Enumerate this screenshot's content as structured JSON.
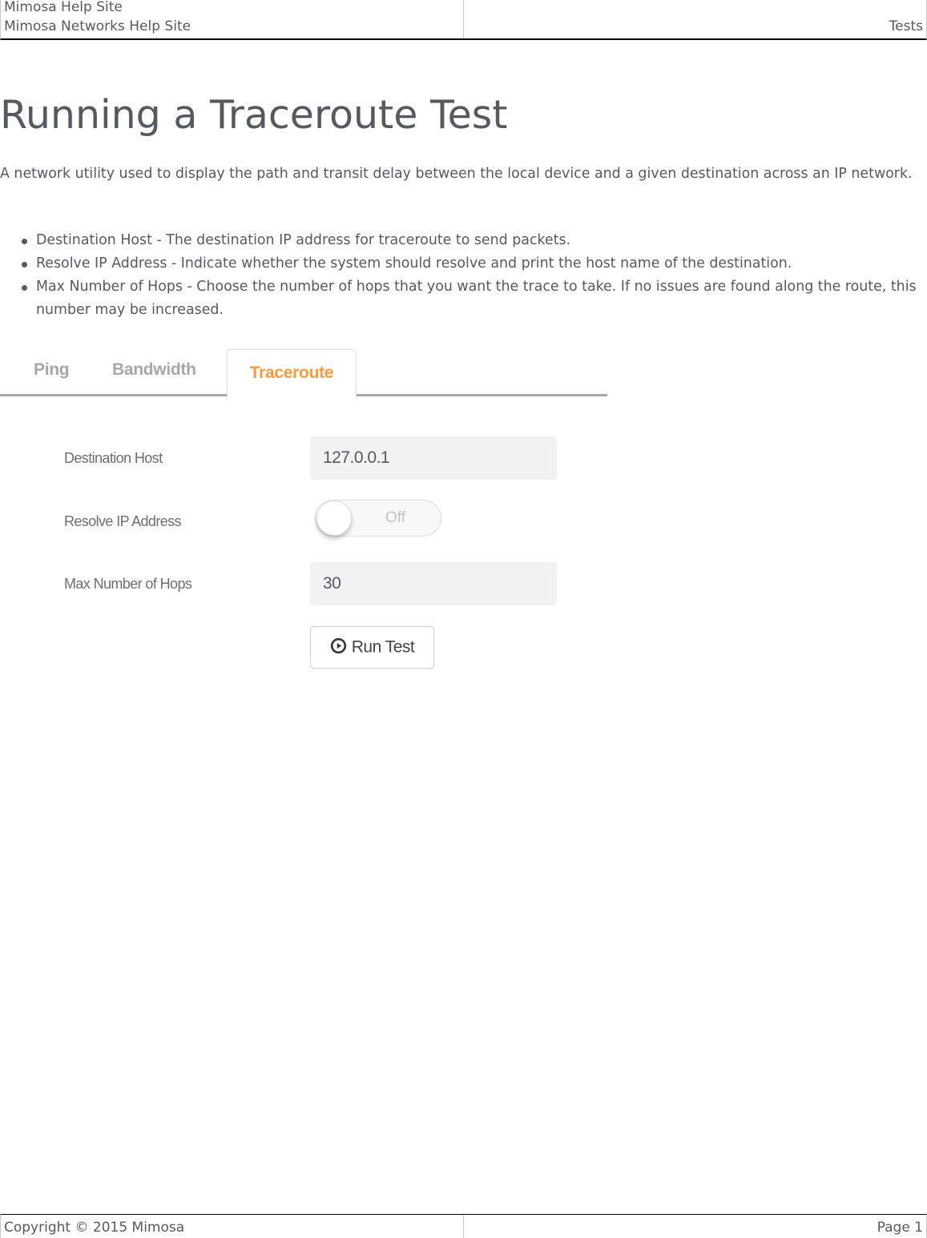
{
  "header": {
    "site_title": "Mimosa Help Site",
    "site_subtitle": "Mimosa Networks Help Site",
    "section": "Tests"
  },
  "article": {
    "title": "Running a Traceroute Test",
    "intro": "A network utility used to display the path and transit delay between the local device and a given destination across an IP network.",
    "bullets": [
      "Destination Host - The destination IP address for traceroute to send packets.",
      "Resolve IP Address - Indicate whether the system should resolve and print the host name of the destination.",
      "Max Number of Hops - Choose the number of hops that you want the trace to take. If no issues are found along the route, this number may be increased."
    ]
  },
  "ui": {
    "tabs": [
      {
        "label": "Ping",
        "active": false
      },
      {
        "label": "Bandwidth",
        "active": false
      },
      {
        "label": "Traceroute",
        "active": true
      }
    ],
    "accent_color": "#ff9a3c",
    "form": {
      "destination_host": {
        "label": "Destination Host",
        "value": "127.0.0.1"
      },
      "resolve_ip": {
        "label": "Resolve IP Address",
        "state": "Off"
      },
      "max_hops": {
        "label": "Max Number of Hops",
        "value": "30"
      },
      "run_button": {
        "label": "Run Test",
        "icon": "play-circle-icon"
      }
    }
  },
  "footer": {
    "copyright": "Copyright © 2015 Mimosa",
    "page": "Page 1"
  }
}
